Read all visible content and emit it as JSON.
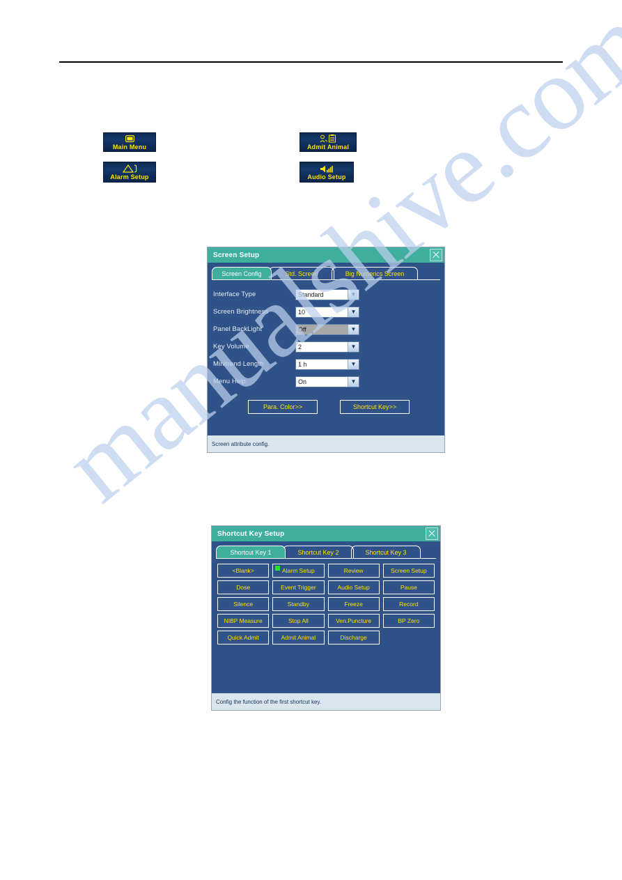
{
  "page": {
    "watermark": "manualshive.com"
  },
  "hardkeys": [
    {
      "id": "main-menu",
      "label": "Main Menu",
      "icon": "monitor-screen-icon"
    },
    {
      "id": "admit-animal",
      "label": "Admit Animal",
      "icon": "admit-animal-clipboard-icon"
    },
    {
      "id": "alarm-setup",
      "label": "Alarm Setup",
      "icon": "alarm-triangle-icon"
    },
    {
      "id": "audio-setup",
      "label": "Audio Setup",
      "icon": "speaker-icon"
    }
  ],
  "screen_setup": {
    "title": "Screen Setup",
    "close_label": "close-icon",
    "tabs": [
      {
        "label": "Screen Config",
        "active": true
      },
      {
        "label": "Std. Screen",
        "active": false
      },
      {
        "label": "Big Numerics Screen",
        "active": false
      }
    ],
    "fields": [
      {
        "label": "Interface Type",
        "value": "Standard",
        "disabled": false
      },
      {
        "label": "Screen Brightness",
        "value": "10",
        "disabled": false
      },
      {
        "label": "Panel BackLight",
        "value": "Off",
        "disabled": true
      },
      {
        "label": "Key Volume",
        "value": "2",
        "disabled": false
      },
      {
        "label": "Minitrend Length",
        "value": "1 h",
        "disabled": false
      },
      {
        "label": "Menu Help",
        "value": "On",
        "disabled": false
      }
    ],
    "buttons": [
      {
        "label": "Para. Color>>"
      },
      {
        "label": "Shortcut Key>>"
      }
    ],
    "statusbar": "Screen attribute config."
  },
  "shortcut_setup": {
    "title": "Shortcut Key Setup",
    "close_label": "close-icon",
    "tabs": [
      {
        "label": "Shortcut Key 1",
        "active": true
      },
      {
        "label": "Shortcut Key 2",
        "active": false
      },
      {
        "label": "Shortcut Key 3",
        "active": false
      }
    ],
    "keys": [
      {
        "label": "<Blank>",
        "selected": false
      },
      {
        "label": "Alarm Setup",
        "selected": true
      },
      {
        "label": "Review",
        "selected": false
      },
      {
        "label": "Screen Setup",
        "selected": false
      },
      {
        "label": "Dose",
        "selected": false
      },
      {
        "label": "Event Trigger",
        "selected": false
      },
      {
        "label": "Audio Setup",
        "selected": false
      },
      {
        "label": "Pause",
        "selected": false
      },
      {
        "label": "Silence",
        "selected": false
      },
      {
        "label": "Standby",
        "selected": false
      },
      {
        "label": "Freeze",
        "selected": false
      },
      {
        "label": "Record",
        "selected": false
      },
      {
        "label": "NIBP Measure",
        "selected": false
      },
      {
        "label": "Stop All",
        "selected": false
      },
      {
        "label": "Ven.Puncture",
        "selected": false
      },
      {
        "label": "BP Zero",
        "selected": false
      },
      {
        "label": "Quick Admit",
        "selected": false
      },
      {
        "label": "Admit Animal",
        "selected": false
      },
      {
        "label": "Discharge",
        "selected": false
      }
    ],
    "statusbar": "Config the function of the first shortcut key."
  }
}
